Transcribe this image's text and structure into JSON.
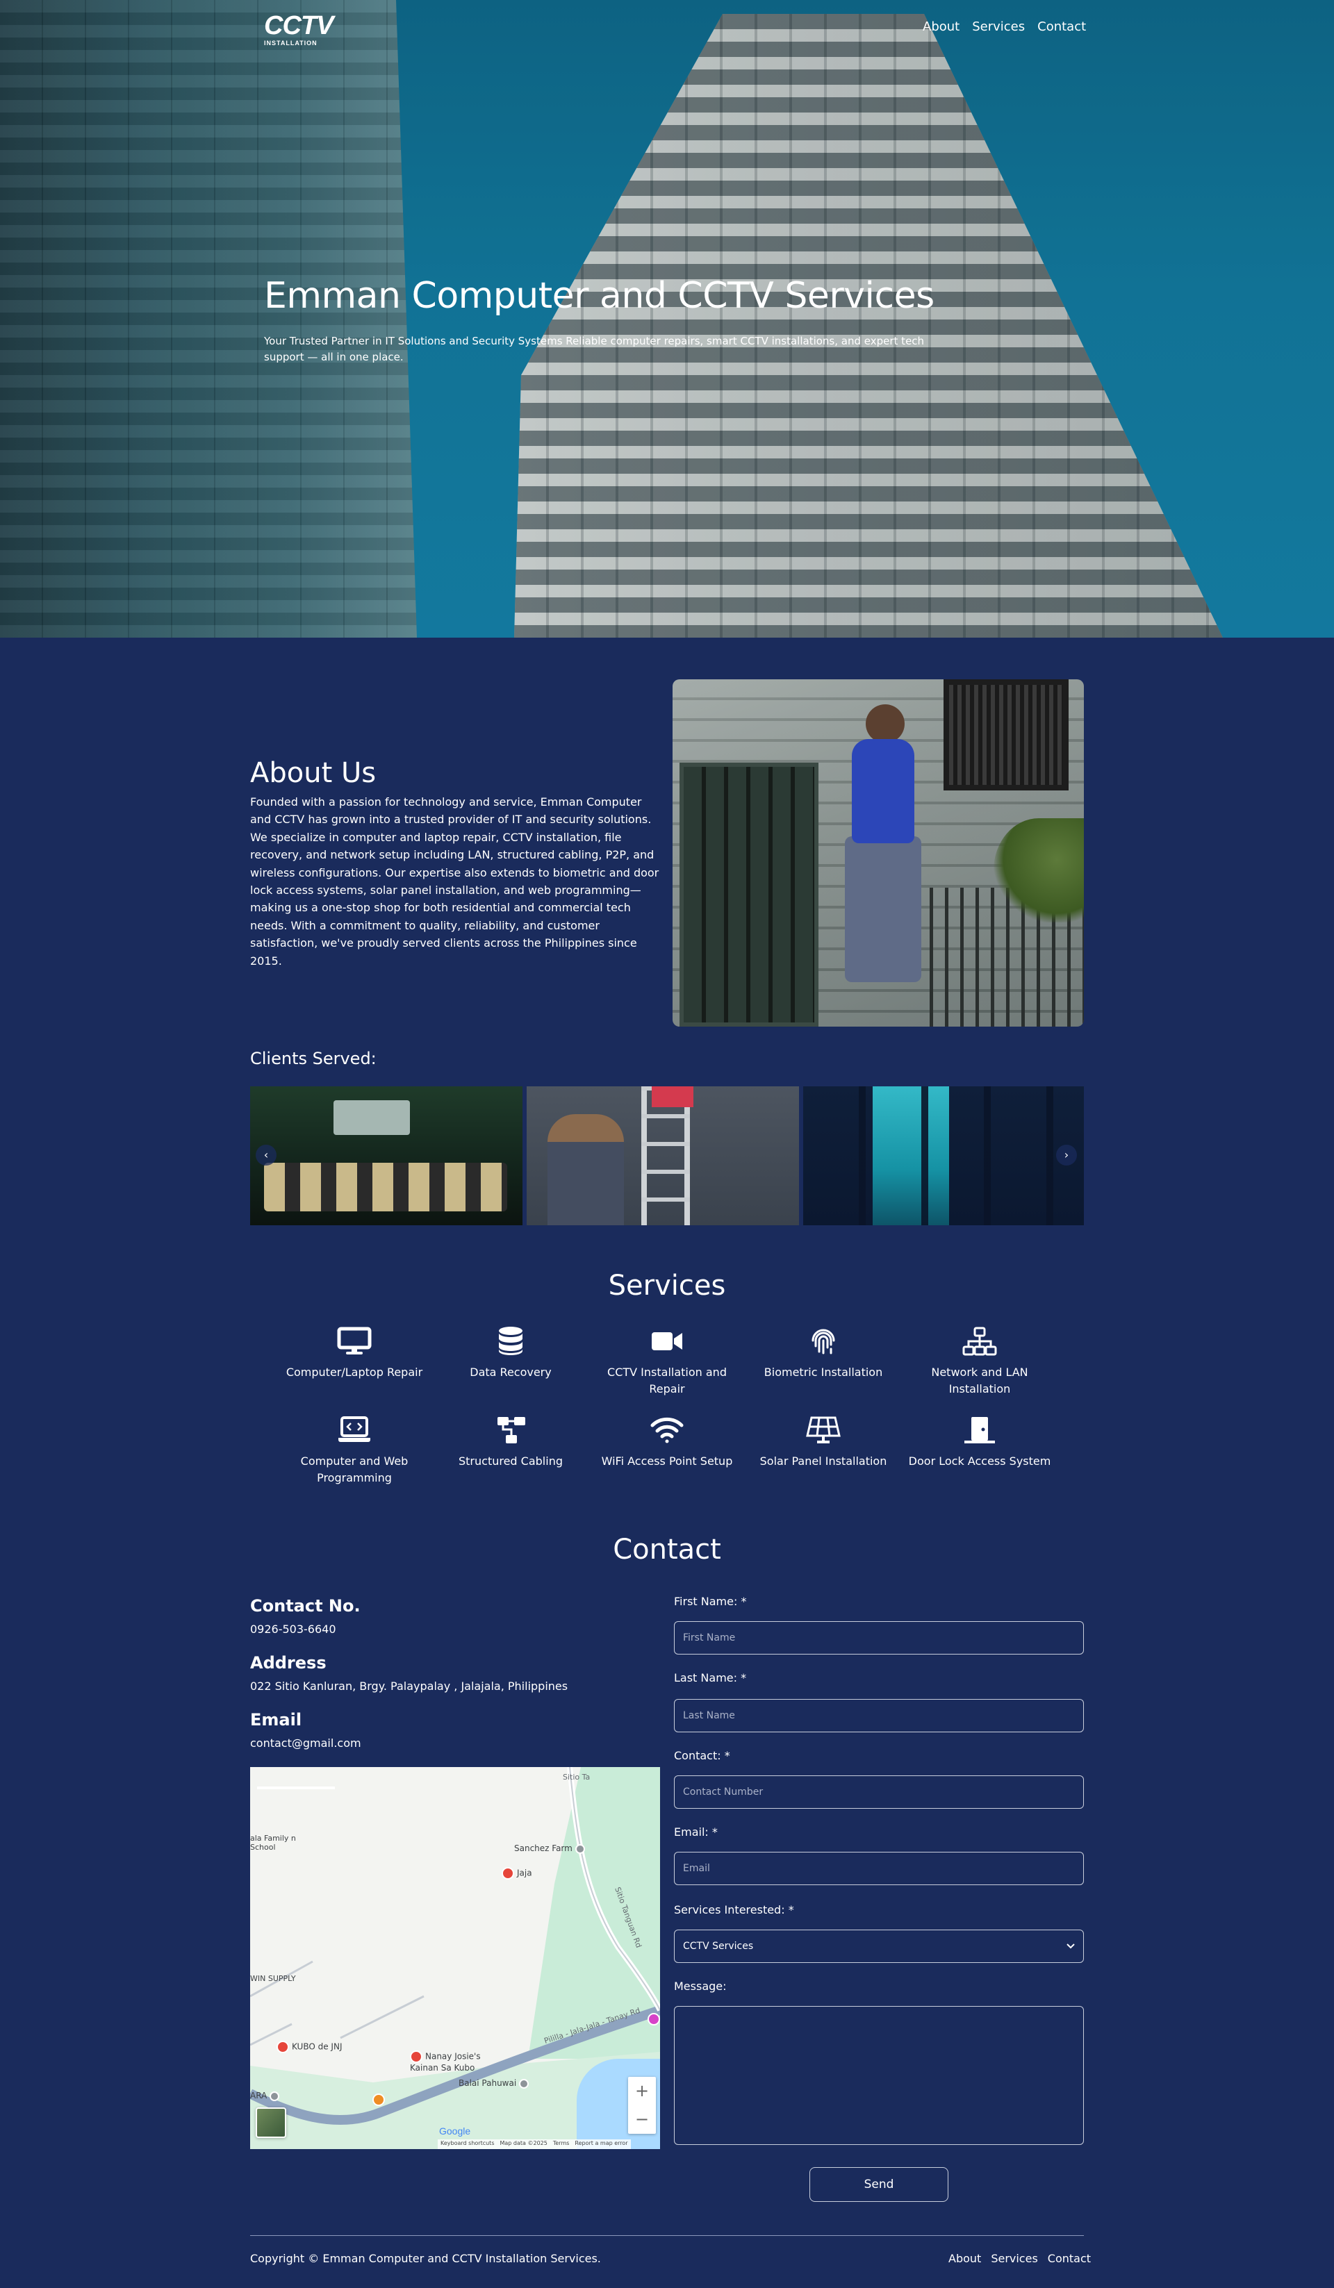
{
  "header": {
    "logo_text": "CCTV",
    "logo_subtext": "INSTALLATION",
    "nav": [
      "About",
      "Services",
      "Contact"
    ]
  },
  "hero": {
    "title": "Emman Computer and CCTV Services",
    "subtitle": "Your Trusted Partner in IT Solutions and Security Systems Reliable computer repairs, smart CCTV installations, and expert tech support — all in one place."
  },
  "about": {
    "title": "About Us",
    "text": "Founded with a passion for technology and service, Emman Computer and CCTV has grown into a trusted provider of IT and security solutions. We specialize in computer and laptop repair, CCTV installation, file recovery, and network setup including LAN, structured cabling, P2P, and wireless configurations. Our expertise also extends to biometric and door lock access systems, solar panel installation, and web programming—making us a one-stop shop for both residential and commercial tech needs. With a commitment to quality, reliability, and customer satisfaction, we've proudly served clients across the Philippines since 2015."
  },
  "clients": {
    "title": "Clients Served:",
    "prev_icon": "chevron-left-icon",
    "next_icon": "chevron-right-icon",
    "prev_glyph": "‹",
    "next_glyph": "›"
  },
  "services": {
    "title": "Services",
    "items": [
      {
        "label": "Computer/Laptop Repair",
        "icon": "monitor-icon"
      },
      {
        "label": "Data Recovery",
        "icon": "database-icon"
      },
      {
        "label": "CCTV Installation and Repair",
        "icon": "video-camera-icon"
      },
      {
        "label": "Biometric Installation",
        "icon": "fingerprint-icon"
      },
      {
        "label": "Network and LAN Installation",
        "icon": "network-icon"
      },
      {
        "label": "Computer and Web Programming",
        "icon": "laptop-code-icon"
      },
      {
        "label": "Structured Cabling",
        "icon": "diagram-icon"
      },
      {
        "label": "WiFi Access Point Setup",
        "icon": "wifi-icon"
      },
      {
        "label": "Solar Panel Installation",
        "icon": "solar-panel-icon"
      },
      {
        "label": "Door Lock Access System",
        "icon": "door-lock-icon"
      }
    ]
  },
  "contact": {
    "title": "Contact",
    "phone_heading": "Contact No.",
    "phone": "0926-503-6640",
    "address_heading": "Address",
    "address": "022 Sitio Kanluran, Brgy. Palaypalay , Jalajala, Philippines",
    "email_heading": "Email",
    "email": "contact@gmail.com",
    "map": {
      "places": [
        "Jaja",
        "Sanchez Farm",
        "KUBO de JNJ",
        "Nanay Josie's Kainan Sa Kubo",
        "Balai Pahuwai",
        "ala Family n School",
        "WIN SUPPLY",
        "ARA"
      ],
      "roads": [
        "Sitio Tanguan Rd",
        "Pililla - Jala-Jala - Tanay Rd",
        "Sitio Ta"
      ],
      "zoom_in": "+",
      "zoom_out": "−",
      "google": "Google",
      "attribution": [
        "Keyboard shortcuts",
        "Map data ©2025",
        "Terms",
        "Report a map error"
      ]
    },
    "form": {
      "first_name_label": "First Name: *",
      "first_name_placeholder": "First Name",
      "last_name_label": "Last Name: *",
      "last_name_placeholder": "Last Name",
      "contact_label": "Contact: *",
      "contact_placeholder": "Contact Number",
      "email_label": "Email: *",
      "email_placeholder": "Email",
      "services_label": "Services Interested: *",
      "services_selected": "CCTV Services",
      "message_label": "Message:",
      "send_label": "Send"
    }
  },
  "footer": {
    "copyright": "Copyright © Emman Computer and CCTV Installation Services.",
    "nav": [
      "About",
      "Services",
      "Contact"
    ]
  },
  "colors": {
    "background": "#1a2b5c",
    "text": "#ffffff",
    "input_border": "#c8cedc"
  }
}
